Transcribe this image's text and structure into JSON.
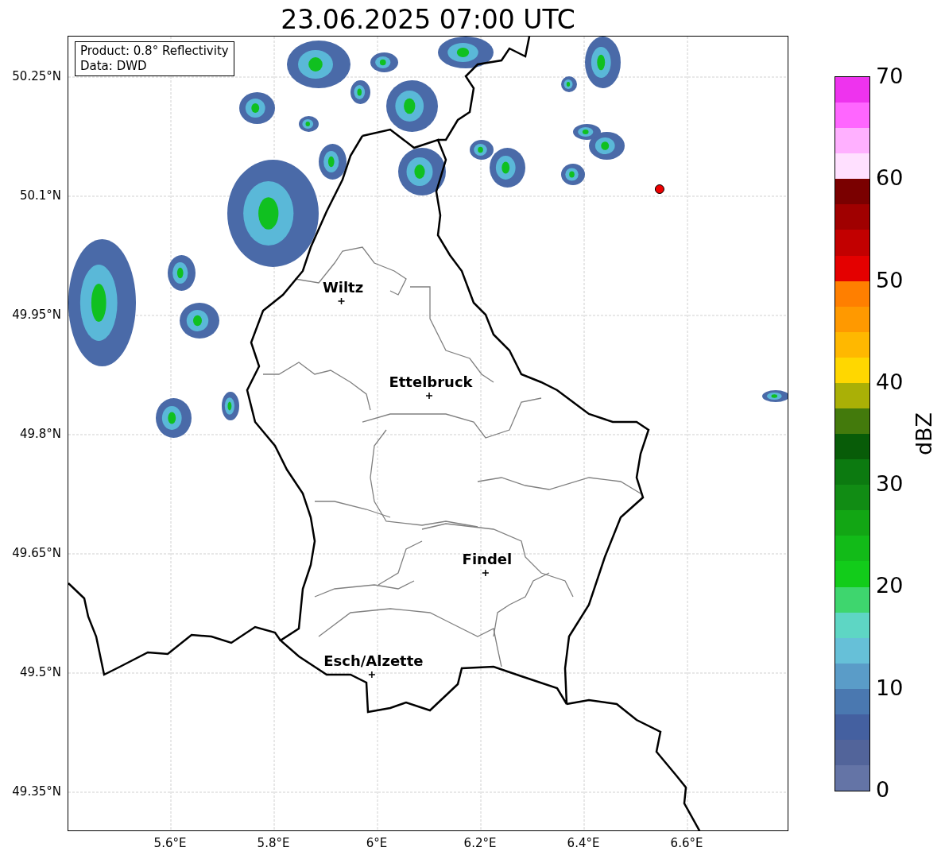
{
  "title": "23.06.2025 07:00 UTC",
  "info_box": {
    "lines": [
      "Product: 0.8° Reflectivity",
      "Data: DWD"
    ]
  },
  "map": {
    "yticks": [
      "50.25°N",
      "50.1°N",
      "49.95°N",
      "49.8°N",
      "49.65°N",
      "49.5°N",
      "49.35°N"
    ],
    "xticks": [
      "5.6°E",
      "5.8°E",
      "6°E",
      "6.2°E",
      "6.4°E",
      "6.6°E"
    ],
    "cities": [
      "Wiltz",
      "Ettelbruck",
      "Findel",
      "Esch/Alzette"
    ]
  },
  "colorbar": {
    "label": "dBZ",
    "ticks": [
      "70",
      "60",
      "50",
      "40",
      "30",
      "20",
      "10",
      "0"
    ],
    "bands": [
      {
        "color": "#ee33ee"
      },
      {
        "color": "#ff66ff"
      },
      {
        "color": "#ffb0ff"
      },
      {
        "color": "#ffe0ff"
      },
      {
        "color": "#7a0000"
      },
      {
        "color": "#a00000"
      },
      {
        "color": "#c20000"
      },
      {
        "color": "#e40000"
      },
      {
        "color": "#ff7f00"
      },
      {
        "color": "#ff9900"
      },
      {
        "color": "#ffb800"
      },
      {
        "color": "#ffd700"
      },
      {
        "color": "#aab006"
      },
      {
        "color": "#437a0c"
      },
      {
        "color": "#085c08"
      },
      {
        "color": "#0c7a10"
      },
      {
        "color": "#118c14"
      },
      {
        "color": "#12a614"
      },
      {
        "color": "#12bb18"
      },
      {
        "color": "#12cc1a"
      },
      {
        "color": "#3ed66e"
      },
      {
        "color": "#5ed6c4"
      },
      {
        "color": "#66c0d8"
      },
      {
        "color": "#5a9cc8"
      },
      {
        "color": "#4a78b0"
      },
      {
        "color": "#4460a0"
      },
      {
        "color": "#52649a"
      },
      {
        "color": "#6474a6"
      }
    ]
  }
}
